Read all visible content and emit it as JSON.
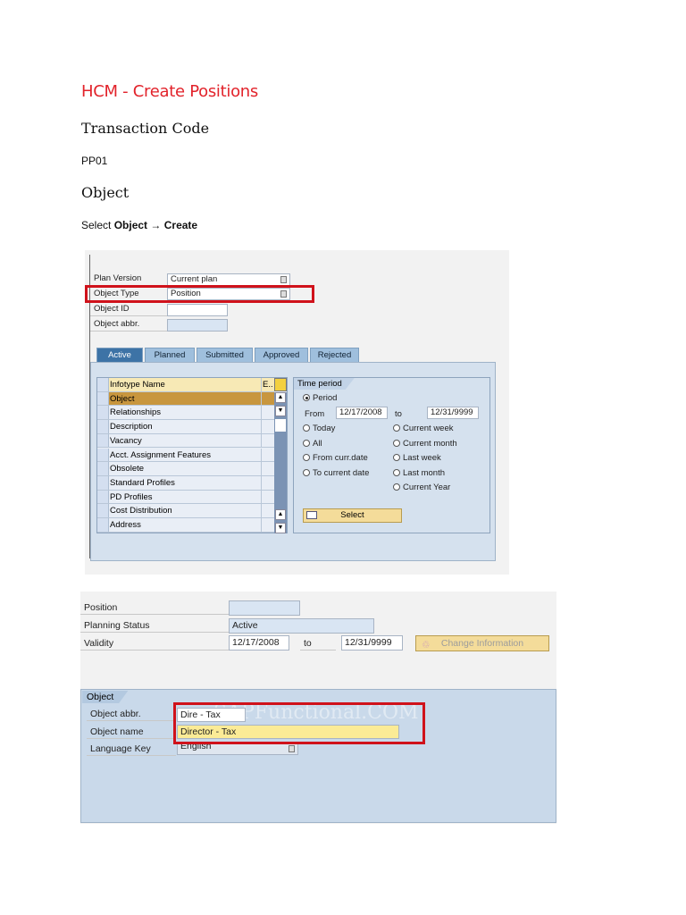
{
  "doc": {
    "title": "HCM - Create Positions",
    "section1": "Transaction Code",
    "tcode": "PP01",
    "section2": "Object",
    "instr_prefix": "Select",
    "instr_obj": "Object",
    "instr_arrow": "→",
    "instr_action": "Create"
  },
  "screen1": {
    "fields": [
      {
        "label": "Plan Version",
        "value": "Current plan"
      },
      {
        "label": "Object Type",
        "value": "Position"
      },
      {
        "label": "Object ID",
        "value": ""
      },
      {
        "label": "Object abbr.",
        "value": ""
      }
    ],
    "tabs": [
      "Active",
      "Planned",
      "Submitted",
      "Approved",
      "Rejected"
    ],
    "table_header": "Infotype Name",
    "table_header_e": "E..",
    "infotypes": [
      "Object",
      "Relationships",
      "Description",
      "Vacancy",
      "Acct. Assignment Features",
      "Obsolete",
      "Standard Profiles",
      "PD Profiles",
      "Cost Distribution",
      "Address"
    ],
    "time_period": {
      "title": "Time period",
      "period": "Period",
      "from_label": "From",
      "from": "12/17/2008",
      "to_label": "to",
      "to": "12/31/9999",
      "left_options": [
        "Today",
        "All",
        "From curr.date",
        "To current date"
      ],
      "right_options": [
        "Current week",
        "Current month",
        "Last week",
        "Last month",
        "Current Year"
      ],
      "select_button": "Select"
    }
  },
  "screen2": {
    "position_label": "Position",
    "planning_status_label": "Planning Status",
    "planning_status": "Active",
    "validity_label": "Validity",
    "valid_from": "12/17/2008",
    "to_label": "to",
    "valid_to": "12/31/9999",
    "change_button": "Change Information",
    "object_tab": "Object",
    "object_abbr_label": "Object abbr.",
    "object_abbr": "Dire - Tax",
    "object_name_label": "Object name",
    "object_name": "Director - Tax",
    "language_label": "Language Key",
    "language": "English",
    "watermark": "SAPFunctional.COM"
  }
}
